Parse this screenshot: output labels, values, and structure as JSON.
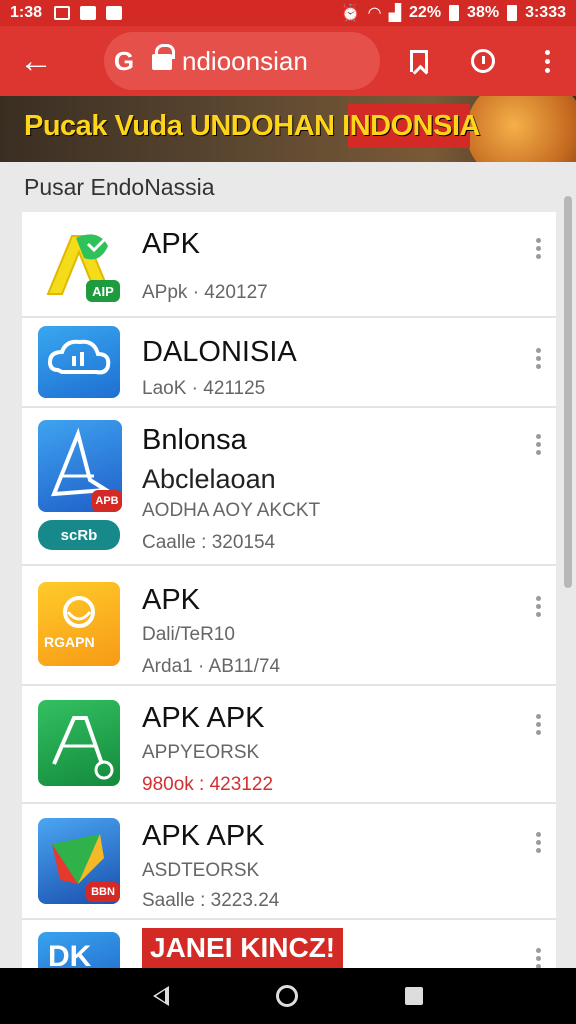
{
  "status_bar": {
    "time": "1:38",
    "battery_text_1": "22%",
    "battery_text_2": "38%",
    "clock_right": "3:333"
  },
  "browser": {
    "g_logo": "G",
    "url": "ndioonsian"
  },
  "banner": {
    "headline": "Pucak Vuda UNDOHAN INDONSIA",
    "accent_color": "#d32a25",
    "text_color": "#ffd51a"
  },
  "section_title": "Pusar EndoNassia",
  "apps": [
    {
      "title": "APK",
      "lines": [
        "APpk · 420127"
      ],
      "badge": "AIP"
    },
    {
      "title": "DALONISIA",
      "lines": [
        "LaoK · 421125"
      ]
    },
    {
      "title": "Bnlonsa",
      "subtitle": "Abclelaoan",
      "lines": [
        "AODHA AOY AKCKT",
        "Caalle : 320154"
      ],
      "badge": "APB",
      "extra_badge": "scRb"
    },
    {
      "title": "APK",
      "lines": [
        "Dali/TeR10",
        "Arda1 · AB11/74"
      ],
      "icon_text": "RGAPN"
    },
    {
      "title": "APK APK",
      "lines": [
        "APPYEORSK",
        "980ok : 423122"
      ]
    },
    {
      "title": "APK APK",
      "lines": [
        "ASDTEORSK",
        "Saalle : 3223.24"
      ],
      "badge": "BBN"
    },
    {
      "title": "JANEI KINCZ!",
      "icon_text": "DK"
    }
  ],
  "colors": {
    "toolbar": "#dd3530",
    "status": "#d42a25",
    "red_text": "#d32f2f"
  }
}
